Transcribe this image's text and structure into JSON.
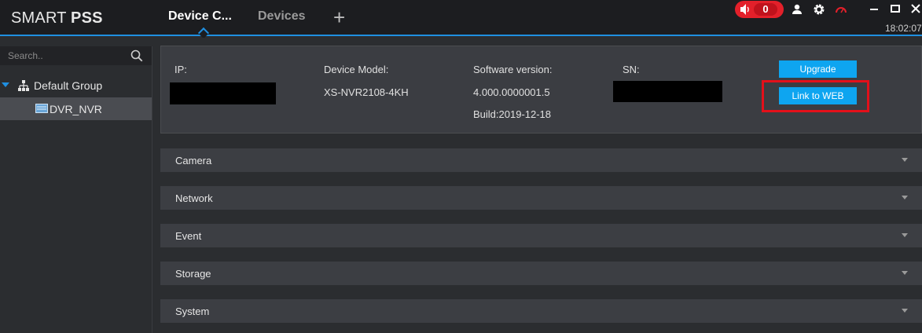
{
  "app": {
    "logo_light": "SMART ",
    "logo_bold": "PSS"
  },
  "tabs": [
    {
      "label": "Device C..."
    },
    {
      "label": "Devices"
    }
  ],
  "alarm": {
    "count": "0"
  },
  "clock": "18:02:07",
  "colors": {
    "accent": "#1f8fe0",
    "alarm": "#e3202a",
    "button": "#0ea5f0",
    "highlight": "#e3101a"
  },
  "sidebar": {
    "search_placeholder": "Search..",
    "group": "Default Group",
    "device": "DVR_NVR"
  },
  "device_info": {
    "ip_label": "IP:",
    "model_label": "Device Model:",
    "model_value": "XS-NVR2108-4KH",
    "software_label": "Software version:",
    "software_value": "4.000.0000001.5",
    "build_value": "Build:2019-12-18",
    "sn_label": "SN:",
    "upgrade_button": "Upgrade",
    "link_web_button": "Link to WEB"
  },
  "sections": [
    {
      "label": "Camera"
    },
    {
      "label": "Network"
    },
    {
      "label": "Event"
    },
    {
      "label": "Storage"
    },
    {
      "label": "System"
    }
  ],
  "icons": [
    "speaker-icon",
    "user-icon",
    "gear-icon",
    "gauge-icon",
    "minimize-icon",
    "maximize-icon",
    "close-icon",
    "search-icon",
    "group-tree-icon",
    "device-icon",
    "plus-icon",
    "expand-arrow-icon"
  ]
}
